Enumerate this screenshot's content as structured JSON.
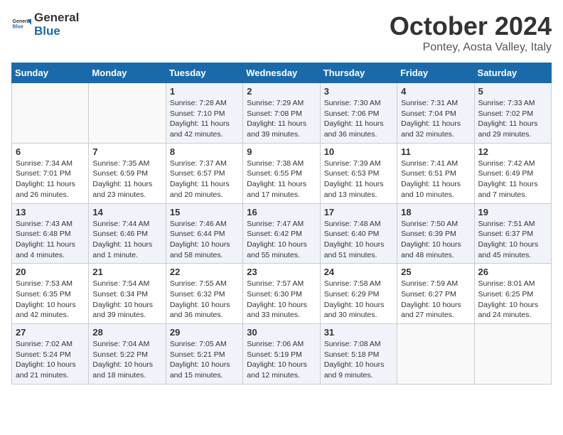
{
  "header": {
    "logo_general": "General",
    "logo_blue": "Blue",
    "month_title": "October 2024",
    "location": "Pontey, Aosta Valley, Italy"
  },
  "weekdays": [
    "Sunday",
    "Monday",
    "Tuesday",
    "Wednesday",
    "Thursday",
    "Friday",
    "Saturday"
  ],
  "weeks": [
    [
      {
        "day": "",
        "info": ""
      },
      {
        "day": "",
        "info": ""
      },
      {
        "day": "1",
        "info": "Sunrise: 7:28 AM\nSunset: 7:10 PM\nDaylight: 11 hours and 42 minutes."
      },
      {
        "day": "2",
        "info": "Sunrise: 7:29 AM\nSunset: 7:08 PM\nDaylight: 11 hours and 39 minutes."
      },
      {
        "day": "3",
        "info": "Sunrise: 7:30 AM\nSunset: 7:06 PM\nDaylight: 11 hours and 36 minutes."
      },
      {
        "day": "4",
        "info": "Sunrise: 7:31 AM\nSunset: 7:04 PM\nDaylight: 11 hours and 32 minutes."
      },
      {
        "day": "5",
        "info": "Sunrise: 7:33 AM\nSunset: 7:02 PM\nDaylight: 11 hours and 29 minutes."
      }
    ],
    [
      {
        "day": "6",
        "info": "Sunrise: 7:34 AM\nSunset: 7:01 PM\nDaylight: 11 hours and 26 minutes."
      },
      {
        "day": "7",
        "info": "Sunrise: 7:35 AM\nSunset: 6:59 PM\nDaylight: 11 hours and 23 minutes."
      },
      {
        "day": "8",
        "info": "Sunrise: 7:37 AM\nSunset: 6:57 PM\nDaylight: 11 hours and 20 minutes."
      },
      {
        "day": "9",
        "info": "Sunrise: 7:38 AM\nSunset: 6:55 PM\nDaylight: 11 hours and 17 minutes."
      },
      {
        "day": "10",
        "info": "Sunrise: 7:39 AM\nSunset: 6:53 PM\nDaylight: 11 hours and 13 minutes."
      },
      {
        "day": "11",
        "info": "Sunrise: 7:41 AM\nSunset: 6:51 PM\nDaylight: 11 hours and 10 minutes."
      },
      {
        "day": "12",
        "info": "Sunrise: 7:42 AM\nSunset: 6:49 PM\nDaylight: 11 hours and 7 minutes."
      }
    ],
    [
      {
        "day": "13",
        "info": "Sunrise: 7:43 AM\nSunset: 6:48 PM\nDaylight: 11 hours and 4 minutes."
      },
      {
        "day": "14",
        "info": "Sunrise: 7:44 AM\nSunset: 6:46 PM\nDaylight: 11 hours and 1 minute."
      },
      {
        "day": "15",
        "info": "Sunrise: 7:46 AM\nSunset: 6:44 PM\nDaylight: 10 hours and 58 minutes."
      },
      {
        "day": "16",
        "info": "Sunrise: 7:47 AM\nSunset: 6:42 PM\nDaylight: 10 hours and 55 minutes."
      },
      {
        "day": "17",
        "info": "Sunrise: 7:48 AM\nSunset: 6:40 PM\nDaylight: 10 hours and 51 minutes."
      },
      {
        "day": "18",
        "info": "Sunrise: 7:50 AM\nSunset: 6:39 PM\nDaylight: 10 hours and 48 minutes."
      },
      {
        "day": "19",
        "info": "Sunrise: 7:51 AM\nSunset: 6:37 PM\nDaylight: 10 hours and 45 minutes."
      }
    ],
    [
      {
        "day": "20",
        "info": "Sunrise: 7:53 AM\nSunset: 6:35 PM\nDaylight: 10 hours and 42 minutes."
      },
      {
        "day": "21",
        "info": "Sunrise: 7:54 AM\nSunset: 6:34 PM\nDaylight: 10 hours and 39 minutes."
      },
      {
        "day": "22",
        "info": "Sunrise: 7:55 AM\nSunset: 6:32 PM\nDaylight: 10 hours and 36 minutes."
      },
      {
        "day": "23",
        "info": "Sunrise: 7:57 AM\nSunset: 6:30 PM\nDaylight: 10 hours and 33 minutes."
      },
      {
        "day": "24",
        "info": "Sunrise: 7:58 AM\nSunset: 6:29 PM\nDaylight: 10 hours and 30 minutes."
      },
      {
        "day": "25",
        "info": "Sunrise: 7:59 AM\nSunset: 6:27 PM\nDaylight: 10 hours and 27 minutes."
      },
      {
        "day": "26",
        "info": "Sunrise: 8:01 AM\nSunset: 6:25 PM\nDaylight: 10 hours and 24 minutes."
      }
    ],
    [
      {
        "day": "27",
        "info": "Sunrise: 7:02 AM\nSunset: 5:24 PM\nDaylight: 10 hours and 21 minutes."
      },
      {
        "day": "28",
        "info": "Sunrise: 7:04 AM\nSunset: 5:22 PM\nDaylight: 10 hours and 18 minutes."
      },
      {
        "day": "29",
        "info": "Sunrise: 7:05 AM\nSunset: 5:21 PM\nDaylight: 10 hours and 15 minutes."
      },
      {
        "day": "30",
        "info": "Sunrise: 7:06 AM\nSunset: 5:19 PM\nDaylight: 10 hours and 12 minutes."
      },
      {
        "day": "31",
        "info": "Sunrise: 7:08 AM\nSunset: 5:18 PM\nDaylight: 10 hours and 9 minutes."
      },
      {
        "day": "",
        "info": ""
      },
      {
        "day": "",
        "info": ""
      }
    ]
  ]
}
